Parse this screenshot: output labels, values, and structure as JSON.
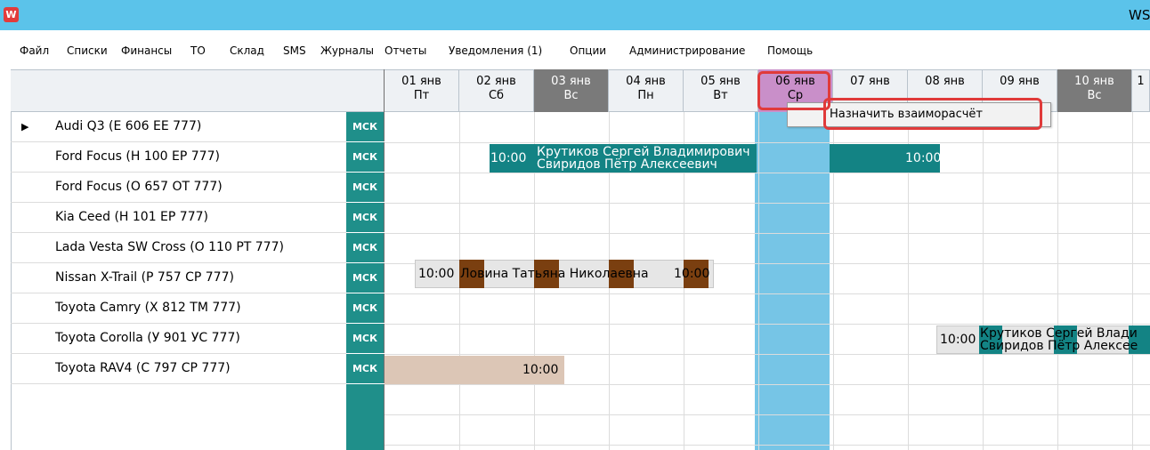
{
  "window": {
    "title": "WS",
    "app_icon": "W"
  },
  "menu": [
    "Файл",
    "Списки",
    "Финансы",
    "ТО",
    "Склад",
    "SMS",
    "Журналы",
    "Отчеты",
    "Уведомления (1)",
    "Опции",
    "Администрирование",
    "Помощь"
  ],
  "days": [
    {
      "date": "01 янв",
      "dow": "Пт",
      "state": "normal"
    },
    {
      "date": "02 янв",
      "dow": "Сб",
      "state": "normal"
    },
    {
      "date": "03 янв",
      "dow": "Вс",
      "state": "weekend"
    },
    {
      "date": "04 янв",
      "dow": "Пн",
      "state": "normal"
    },
    {
      "date": "05 янв",
      "dow": "Вт",
      "state": "normal"
    },
    {
      "date": "06 янв",
      "dow": "Ср",
      "state": "today"
    },
    {
      "date": "07 янв",
      "dow": "",
      "state": "normal"
    },
    {
      "date": "08 янв",
      "dow": "",
      "state": "normal"
    },
    {
      "date": "09 янв",
      "dow": "",
      "state": "normal"
    },
    {
      "date": "10 янв",
      "dow": "Вс",
      "state": "weekend"
    },
    {
      "date": "1",
      "dow": "",
      "state": "normal"
    }
  ],
  "cars": [
    {
      "name": "Audi Q3 (Е 606 ЕЕ 777)",
      "tag": "МСК"
    },
    {
      "name": "Ford Focus (Н 100 ЕР 777)",
      "tag": "МСК"
    },
    {
      "name": "Ford Focus (О 657 ОТ 777)",
      "tag": "МСК"
    },
    {
      "name": "Kia Ceed (Н 101 ЕР 777)",
      "tag": "МСК"
    },
    {
      "name": "Lada Vesta SW Cross (О 110 РТ 777)",
      "tag": "МСК"
    },
    {
      "name": "Nissan X-Trail (Р 757 СР 777)",
      "tag": "МСК"
    },
    {
      "name": "Toyota Camry (Х 812 ТМ 777)",
      "tag": "МСК"
    },
    {
      "name": "Toyota Corolla (У 901 УС 777)",
      "tag": "МСК"
    },
    {
      "name": "Toyota RAV4 (С 797 СР 777)",
      "tag": "МСК"
    }
  ],
  "bookings": {
    "ford_focus_h100": {
      "start_time": "10:00",
      "end_time": "10:00",
      "client": "Крутиков Сергей Владимирович",
      "driver": "Свиридов Пётр Алексеевич"
    },
    "lada_vesta": {
      "start_time": "10:00",
      "end_time": "10:00",
      "client": "Ловина Татьяна Николаевна"
    },
    "corolla": {
      "start_time": "10:00",
      "client_part": "Крутиков Сергей Влади",
      "driver_part": "Свиридов Пётр Алексее"
    },
    "rav4": {
      "end_time": "10:00"
    }
  },
  "context_menu": {
    "item": "Назначить взаиморасчёт"
  },
  "colors": {
    "titlebar": "#5bc3ea",
    "teal": "#138384",
    "brown": "#7a3f10",
    "today": "#c98fc9",
    "today_column": "#76c5e6",
    "highlight": "#e03a3a"
  }
}
